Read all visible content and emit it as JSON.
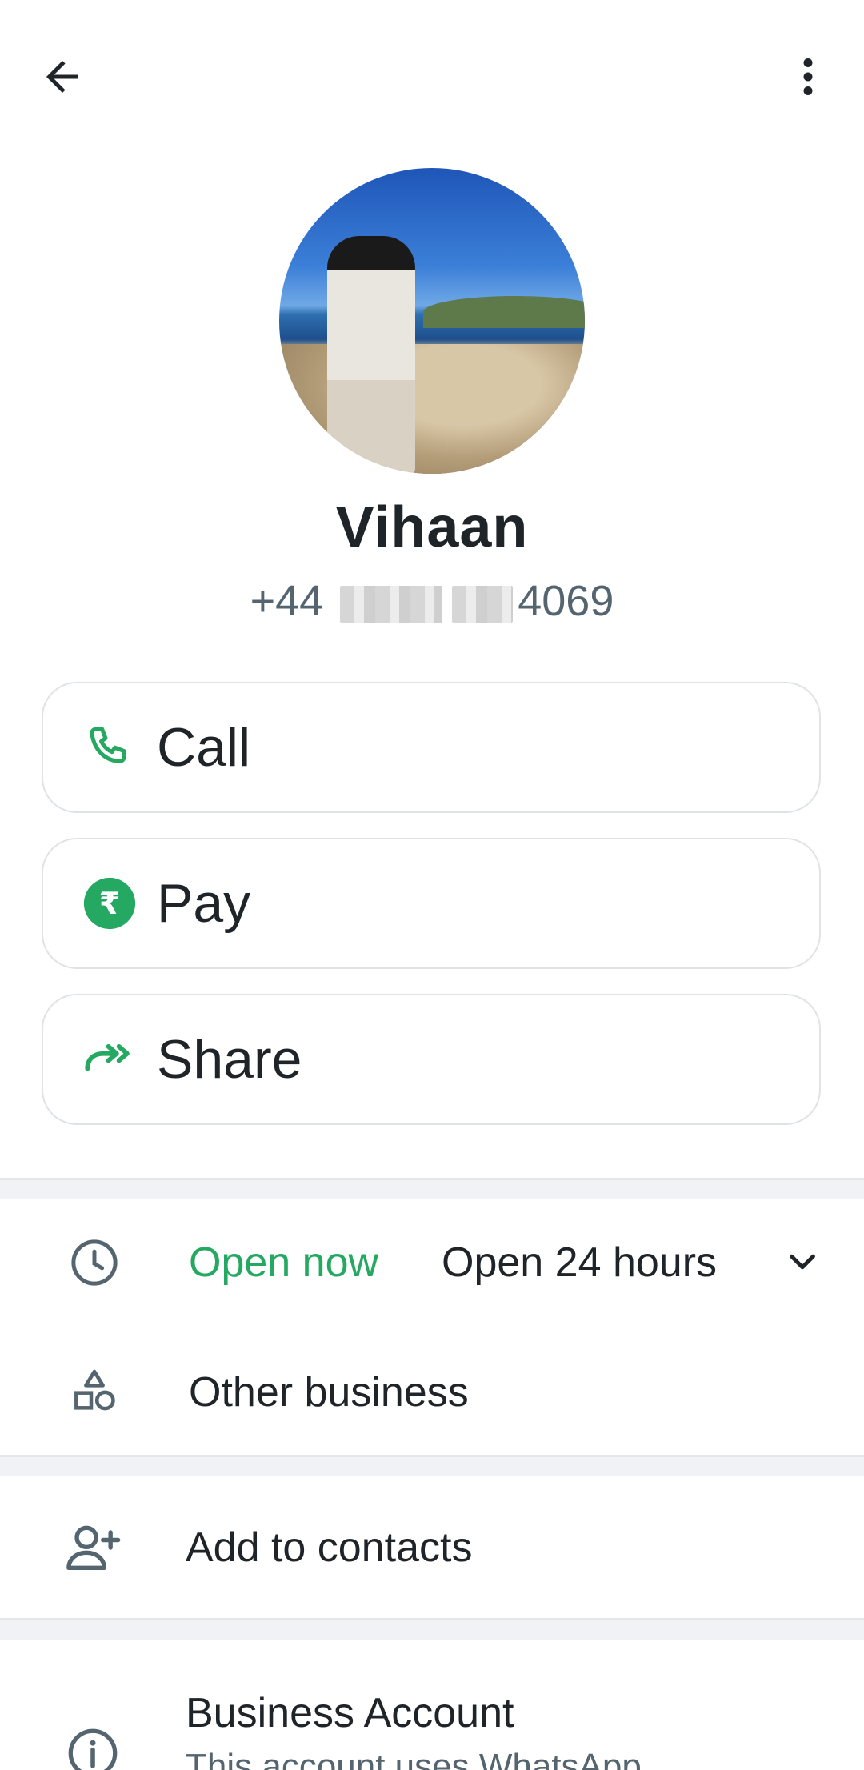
{
  "header": {
    "back_icon": "arrow-left-icon",
    "menu_icon": "more-vertical-icon"
  },
  "profile": {
    "name": "Vihaan",
    "phone_prefix": "+44",
    "phone_suffix": "4069"
  },
  "actions": [
    {
      "label": "Call",
      "icon": "phone-icon"
    },
    {
      "label": "Pay",
      "icon": "rupee-icon"
    },
    {
      "label": "Share",
      "icon": "share-forward-icon"
    }
  ],
  "business_hours": {
    "status": "Open now",
    "hours": "Open 24 hours",
    "icon": "clock-icon"
  },
  "category": {
    "label": "Other business",
    "icon": "shapes-icon"
  },
  "add_contact": {
    "label": "Add to contacts",
    "icon": "add-person-icon"
  },
  "business_account": {
    "title": "Business Account",
    "subtitle": "This account uses WhatsApp",
    "icon": "info-icon"
  },
  "colors": {
    "accent": "#25a862",
    "text": "#1f2428",
    "secondary": "#54656f"
  }
}
